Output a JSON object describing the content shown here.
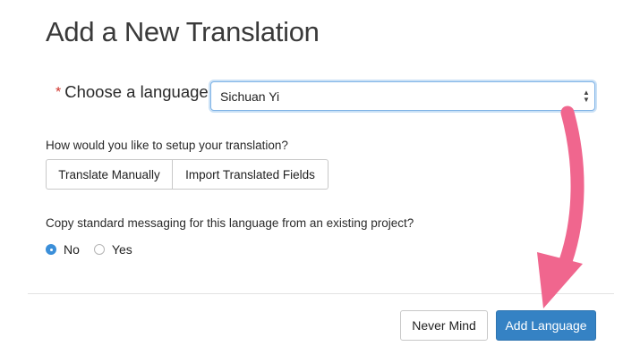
{
  "dialog": {
    "title": "Add a New Translation",
    "language_required_mark": "*",
    "language_label": "Choose a language",
    "language_selected": "Sichuan Yi",
    "setup_question": "How would you like to setup your translation?",
    "setup_options": [
      "Translate Manually",
      "Import Translated Fields"
    ],
    "copy_question": "Copy standard messaging for this language from an existing project?",
    "copy_options": [
      {
        "label": "No",
        "checked": true
      },
      {
        "label": "Yes",
        "checked": false
      }
    ],
    "cancel_label": "Never Mind",
    "submit_label": "Add Language"
  },
  "colors": {
    "primary_button": "#3582c4",
    "radio_checked": "#3b8fd9",
    "required_mark": "#d0342c",
    "annotation_arrow": "#f0668e"
  },
  "icons": {
    "select_arrows": "select-updown-icon",
    "annotation": "pink-arrow-icon"
  }
}
